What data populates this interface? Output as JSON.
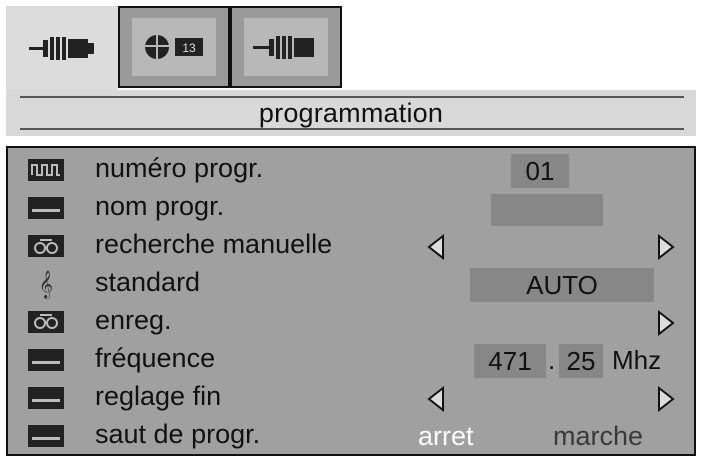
{
  "tabs": [
    {
      "icon": "antenna-connector-icon",
      "active": true
    },
    {
      "icon": "satellite-channel-icon",
      "active": false,
      "badge": "13"
    },
    {
      "icon": "cable-connector-icon",
      "active": false
    }
  ],
  "title": "programmation",
  "rows": [
    {
      "icon": "channel-number-icon",
      "label": "numéro progr.",
      "value": "01"
    },
    {
      "icon": "name-icon",
      "label": "nom progr.",
      "value": ""
    },
    {
      "icon": "search-icon",
      "label": "recherche manuelle"
    },
    {
      "icon": "treble-clef-icon",
      "label": "standard",
      "value": "AUTO"
    },
    {
      "icon": "record-icon",
      "label": "enreg."
    },
    {
      "icon": "frequency-icon",
      "label": "fréquence",
      "value_main": "471",
      "value_sep": ".",
      "value_dec": "25",
      "unit": "Mhz"
    },
    {
      "icon": "fine-tune-icon",
      "label": "reglage fin"
    },
    {
      "icon": "skip-icon",
      "label": "saut de progr.",
      "option_selected": "arret",
      "option_other": "marche"
    }
  ],
  "colors": {
    "panel": "#a0a0a0",
    "value_box": "#878787",
    "title_bar": "#d8d8d8",
    "selected_option": "#ffffff",
    "unselected_option": "#3a3a3a"
  }
}
